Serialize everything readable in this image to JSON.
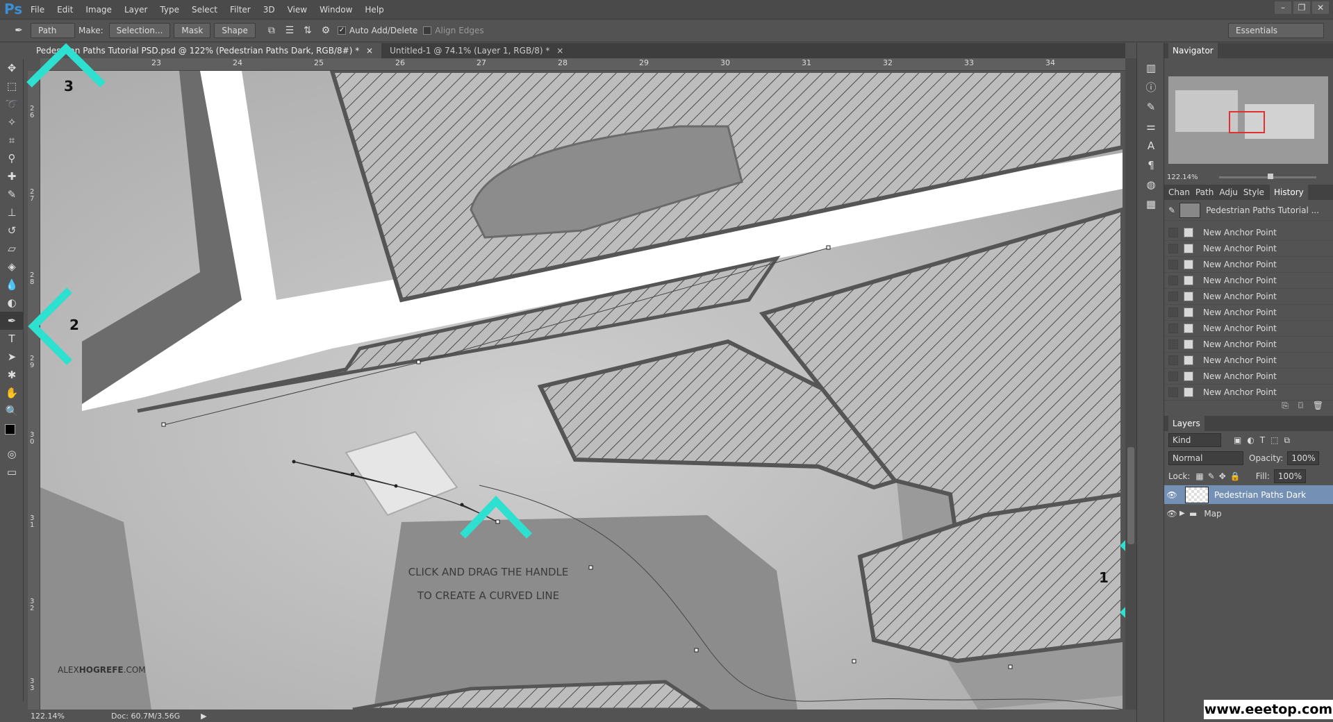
{
  "app": {
    "logo": "Ps"
  },
  "menu": [
    "File",
    "Edit",
    "Image",
    "Layer",
    "Type",
    "Select",
    "Filter",
    "3D",
    "View",
    "Window",
    "Help"
  ],
  "window_controls": [
    "–",
    "❐",
    "✕"
  ],
  "options": {
    "tool_mode": "Path",
    "make_label": "Make:",
    "selection_btn": "Selection...",
    "mask_btn": "Mask",
    "shape_btn": "Shape",
    "auto_add_delete": "Auto Add/Delete",
    "align_edges": "Align Edges",
    "workspace": "Essentials"
  },
  "tabs": [
    {
      "label": "Pedestrian Paths Tutorial PSD.psd @ 122% (Pedestrian Paths Dark, RGB/8#) *",
      "close": "×"
    },
    {
      "label": "Untitled-1 @ 74.1% (Layer 1, RGB/8) *",
      "close": "×"
    }
  ],
  "ruler": {
    "top": [
      "23",
      "24",
      "25",
      "26",
      "27",
      "28",
      "29",
      "30",
      "31",
      "32",
      "33",
      "34"
    ],
    "left": [
      "26",
      "27",
      "28",
      "29",
      "30",
      "31",
      "32",
      "33"
    ]
  },
  "canvas": {
    "instruction_line1": "CLICK AND DRAG THE HANDLE",
    "instruction_line2": "TO CREATE A CURVED LINE",
    "watermark_light": "ALEX",
    "watermark_bold": "HOGREFE",
    "watermark_end": ".COM",
    "step_labels": [
      "1",
      "2",
      "3"
    ],
    "accent_color": "#2de0d0"
  },
  "status": {
    "zoom": "122.14%",
    "doc": "Doc: 60.7M/3.56G"
  },
  "navigator": {
    "title": "Navigator",
    "zoom": "122.14%"
  },
  "history": {
    "tabs": [
      "Chan",
      "Path",
      "Adju",
      "Style",
      "History"
    ],
    "snapshot": "Pedestrian Paths Tutorial ...",
    "items": [
      "New Anchor Point",
      "New Anchor Point",
      "New Anchor Point",
      "New Anchor Point",
      "New Anchor Point",
      "New Anchor Point",
      "New Anchor Point",
      "New Anchor Point",
      "New Anchor Point",
      "New Anchor Point",
      "New Anchor Point"
    ]
  },
  "layers": {
    "title": "Layers",
    "kind": "Kind",
    "blend": "Normal",
    "opacity_label": "Opacity:",
    "opacity": "100%",
    "lock_label": "Lock:",
    "fill_label": "Fill:",
    "fill": "100%",
    "items": [
      {
        "name": "Pedestrian Paths Dark",
        "selected": true
      },
      {
        "name": "Map",
        "selected": false
      }
    ]
  },
  "site_watermark": "www.eeetop.com"
}
